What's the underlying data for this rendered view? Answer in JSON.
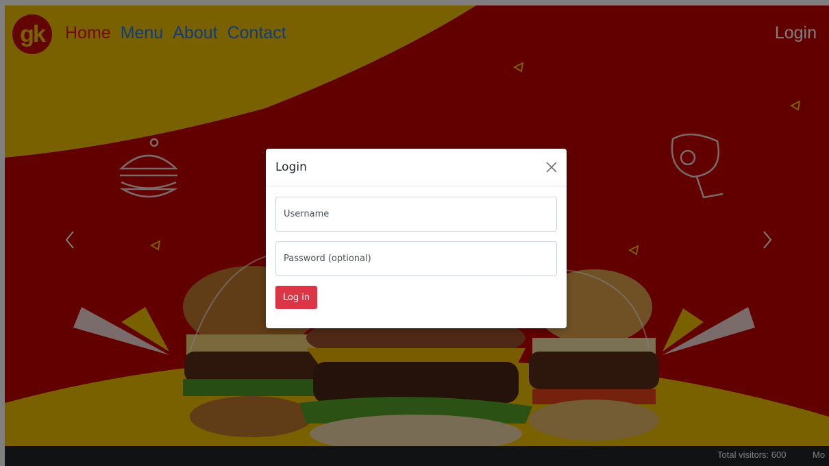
{
  "nav": {
    "logo_text": "gk",
    "items": [
      {
        "label": "Home",
        "active": true
      },
      {
        "label": "Menu",
        "active": false
      },
      {
        "label": "About",
        "active": false
      },
      {
        "label": "Contact",
        "active": false
      }
    ],
    "login_label": "Login"
  },
  "modal": {
    "title": "Login",
    "username_placeholder": "Username",
    "password_placeholder": "Password (optional)",
    "submit_label": "Log in"
  },
  "footer": {
    "visitors_text": "Total visitors: 600",
    "more_text": "Mo"
  },
  "colors": {
    "hero_red": "#c40000",
    "hero_yellow": "#f2c200",
    "button_red": "#dc3545",
    "footer_dark": "#202428"
  }
}
